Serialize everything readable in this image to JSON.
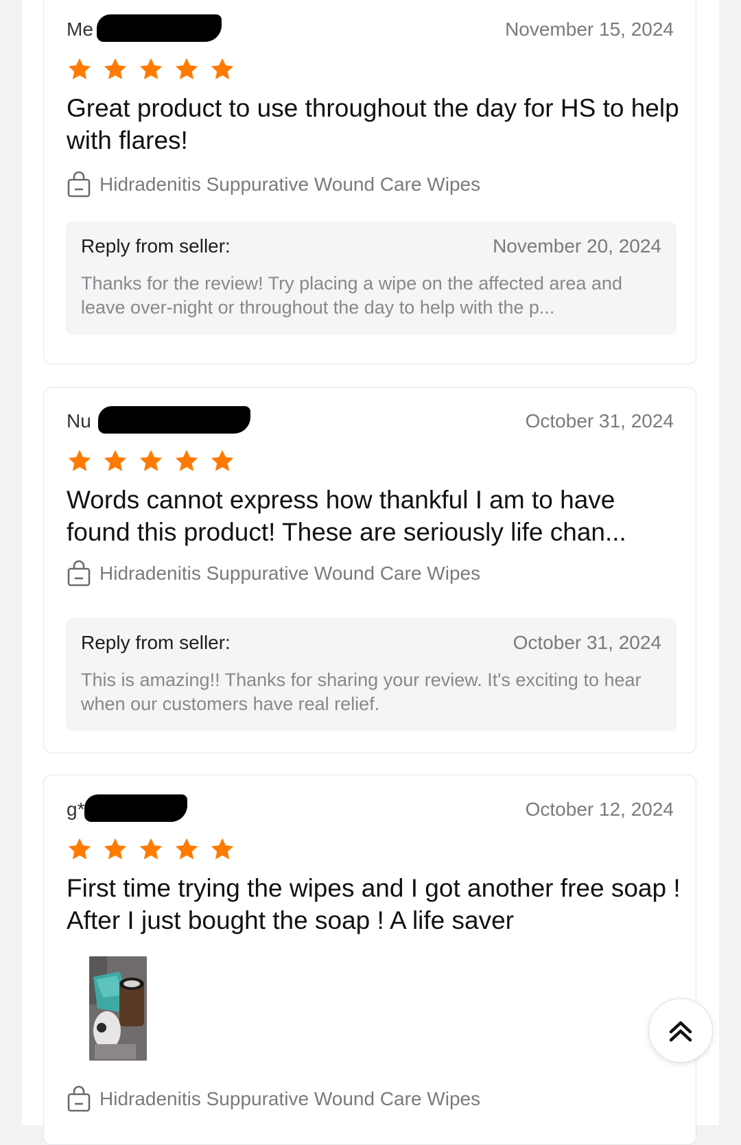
{
  "reviews": [
    {
      "reviewer": "Me",
      "date": "November 15, 2024",
      "rating": 5,
      "title": "Great product to use throughout the day for HS to help with flares!",
      "product": "Hidradenitis Suppurative Wound Care Wipes",
      "reply": {
        "label": "Reply from seller:",
        "date": "November 20, 2024",
        "text": "Thanks for the review! Try placing a wipe on the affected area and leave over-night or throughout the day to help with the p..."
      }
    },
    {
      "reviewer": "Nu",
      "date": "October 31, 2024",
      "rating": 5,
      "title": "Words cannot express how thankful I am to have found this product! These are seriously life chan...",
      "product": "Hidradenitis Suppurative Wound Care Wipes",
      "reply": {
        "label": "Reply from seller:",
        "date": "October 31, 2024",
        "text": "This is amazing!! Thanks for sharing your review. It's exciting to hear when our customers have real relief."
      }
    },
    {
      "reviewer": "g*",
      "date": "October 12, 2024",
      "rating": 5,
      "title": "First time trying the wipes and I got another free soap ! After I just bought the soap ! A life saver",
      "product": "Hidradenitis Suppurative Wound Care Wipes"
    }
  ],
  "colors": {
    "star": "#ff7a00",
    "reply_bg": "#f4f5f7",
    "muted_text": "#7a7a7a"
  },
  "icons": {
    "rating": "star-icon",
    "product": "shopping-bag-icon",
    "scroll_top": "double-chevron-up-icon"
  }
}
